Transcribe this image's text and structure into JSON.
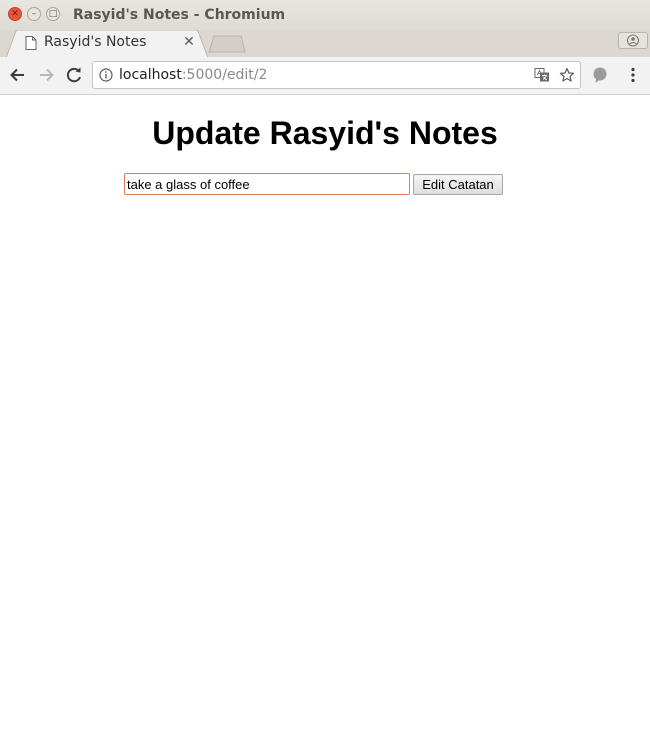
{
  "window": {
    "title": "Rasyid's Notes - Chromium",
    "close_glyph": "✕",
    "minimize_glyph": "–",
    "maximize_glyph": "□"
  },
  "tab": {
    "title": "Rasyid's Notes",
    "close_glyph": "✕",
    "icon": "page-icon"
  },
  "toolbar": {
    "back_icon": "arrow-left-icon",
    "forward_icon": "arrow-right-icon",
    "reload_icon": "reload-icon",
    "info_icon": "info-icon",
    "translate_icon": "translate-icon",
    "bookmark_icon": "star-icon",
    "extension_icon": "extension-icon",
    "menu_icon": "menu-dots-icon"
  },
  "address": {
    "host": "localhost",
    "path": ":5000/edit/2"
  },
  "page": {
    "heading": "Update Rasyid's Notes",
    "note_value": "take a glass of coffee",
    "submit_label": "Edit Catatan"
  },
  "colors": {
    "close_button": "#e9563a",
    "input_focus_border": "#e4785a"
  }
}
